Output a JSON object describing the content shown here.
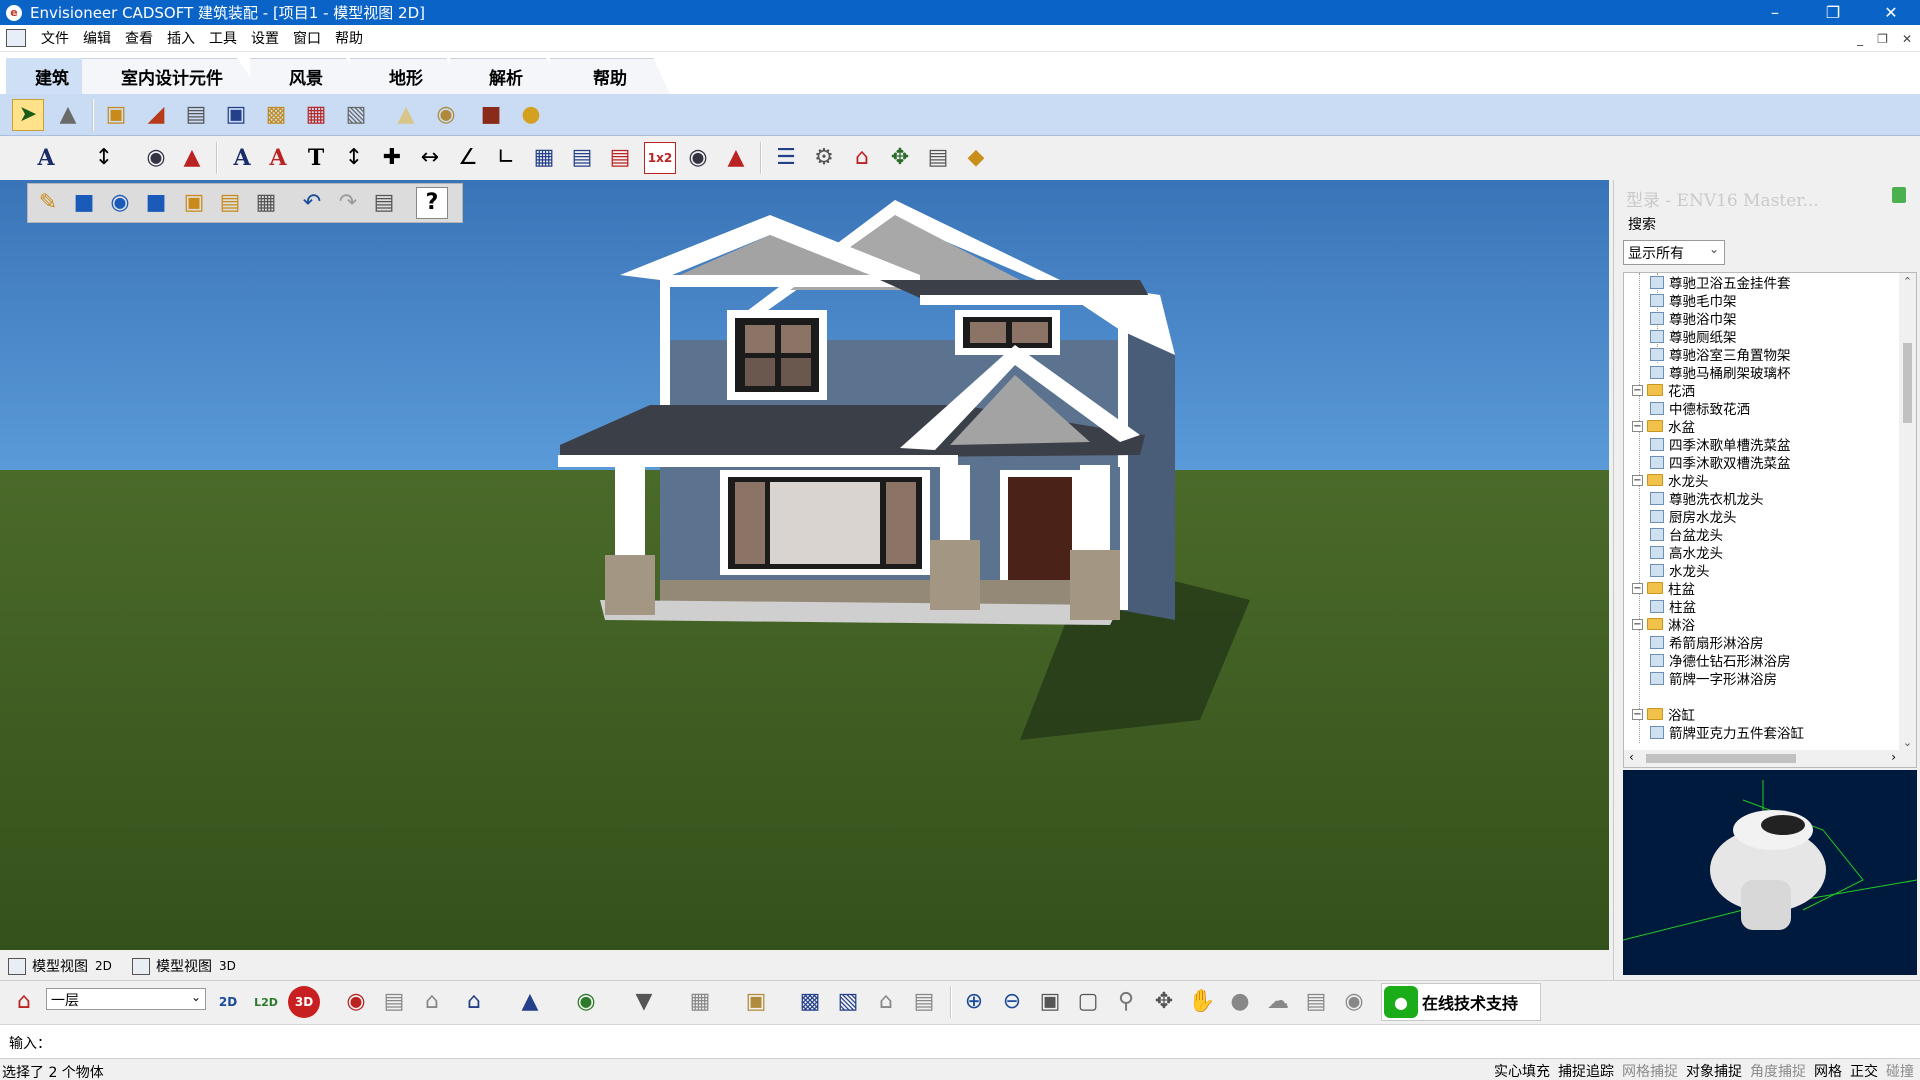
{
  "window": {
    "title": "Envisioneer CADSOFT 建筑装配 - [项目1 - 模型视图 2D]",
    "app_icon": "envisioneer-logo-icon",
    "controls": [
      "minimize-icon",
      "restore-icon",
      "close-icon"
    ]
  },
  "menu": {
    "items": [
      "文件",
      "编辑",
      "查看",
      "插入",
      "工具",
      "设置",
      "窗口",
      "帮助"
    ]
  },
  "ribbon": {
    "tabs": [
      "建筑",
      "室内设计元件",
      "风景",
      "地形",
      "解析",
      "帮助"
    ],
    "active_tab": "室内设计元件"
  },
  "toolbars": {
    "interior": [
      "select-arrow-icon",
      "paint-tool-icon",
      "cabinet-icon",
      "wall-cabinet-icon",
      "appliance-icon",
      "electronics-icon",
      "furniture-chair-icon",
      "window-treatment-icon",
      "fixture-icon",
      "lamp-icon",
      "plumbing-icon",
      "fireplace-icon",
      "misc-element-icon"
    ],
    "annotation": [
      "text-style-icon",
      "dimension-icon",
      "room-label-icon",
      "tag-icon",
      "text-icon",
      "text-edit-icon",
      "text-box-icon",
      "dimension-vertical-icon",
      "dimension-cross-icon",
      "dimension-horizontal-icon",
      "angle-dimension-icon",
      "elevation-icon",
      "stair-icon",
      "railing-icon",
      "ruler-icon",
      "scale-1x2-icon",
      "room-area-icon",
      "roof-tag-icon",
      "list-icon",
      "gear-icon",
      "house-view-icon",
      "resize-icon",
      "chart-icon",
      "layers-icon"
    ],
    "file": [
      "new-file-icon",
      "open-folder-icon",
      "open-web-icon",
      "folder-icon",
      "save-icon",
      "save-as-icon",
      "book-icon",
      "undo-icon",
      "redo-icon",
      "print-icon",
      "help-icon"
    ]
  },
  "viewport": {
    "sky_color": "#4a87c9",
    "grass_color": "#3d5a22",
    "house_siding_color": "#5c7390",
    "roof_color": "#3b3f47"
  },
  "library": {
    "title": "型录 - ENV16 Master...",
    "search_label": "搜索",
    "filter_value": "显示所有",
    "tree": [
      {
        "type": "item",
        "label": "尊驰卫浴五金挂件套"
      },
      {
        "type": "item",
        "label": "尊驰毛巾架"
      },
      {
        "type": "item",
        "label": "尊驰浴巾架"
      },
      {
        "type": "item",
        "label": "尊驰厕纸架"
      },
      {
        "type": "item",
        "label": "尊驰浴室三角置物架"
      },
      {
        "type": "item",
        "label": "尊驰马桶刷架玻璃杯"
      },
      {
        "type": "folder",
        "label": "花洒"
      },
      {
        "type": "item",
        "label": "中德标致花洒"
      },
      {
        "type": "folder",
        "label": "水盆"
      },
      {
        "type": "item",
        "label": "四季沐歌单槽洗菜盆"
      },
      {
        "type": "item",
        "label": "四季沐歌双槽洗菜盆"
      },
      {
        "type": "folder",
        "label": "水龙头"
      },
      {
        "type": "item",
        "label": "尊驰洗衣机龙头"
      },
      {
        "type": "item",
        "label": "厨房水龙头"
      },
      {
        "type": "item",
        "label": "台盆龙头"
      },
      {
        "type": "item",
        "label": "高水龙头"
      },
      {
        "type": "item",
        "label": "水龙头"
      },
      {
        "type": "folder",
        "label": "柱盆"
      },
      {
        "type": "item",
        "label": "柱盆"
      },
      {
        "type": "folder",
        "label": "淋浴"
      },
      {
        "type": "item",
        "label": "希箭扇形淋浴房"
      },
      {
        "type": "item",
        "label": "净德仕钻石形淋浴房"
      },
      {
        "type": "item",
        "label": "箭牌一字形淋浴房"
      },
      {
        "type": "folder",
        "label": "浴缸"
      },
      {
        "type": "item",
        "label": "箭牌亚克力五件套浴缸"
      }
    ],
    "preview_bg": "#001a3d"
  },
  "view_tabs": [
    {
      "label": "模型视图",
      "suffix": "2D"
    },
    {
      "label": "模型视图",
      "suffix": "3D"
    }
  ],
  "bottom_toolbar": {
    "layer_value": "一层",
    "support_label": "在线技术支持",
    "icons": [
      "layer-icon",
      "2d-view-icon",
      "split-2d-icon",
      "3d-view-icon",
      "camera-icon",
      "walkthrough-icon",
      "presentation-icon",
      "exterior-icon",
      "interior-icon",
      "roof-view-icon",
      "photo-icon",
      "lighting-icon",
      "wall-icon",
      "block-icon",
      "material-icon",
      "display-icon",
      "house-icon",
      "render-icon",
      "zoom-in-icon",
      "zoom-out-icon",
      "zoom-fit-icon",
      "zoom-window-icon",
      "zoom-icon",
      "zoom-extents-icon",
      "pan-hand-icon",
      "walk-icon",
      "orbit-icon",
      "rotate-icon",
      "camera-settings-icon",
      "wechat-icon"
    ]
  },
  "command": {
    "label": "输入：",
    "value": ""
  },
  "status": {
    "text": "选择了 2 个物体",
    "toggles": [
      {
        "label": "实心填充",
        "on": true
      },
      {
        "label": "捕捉追踪",
        "on": true
      },
      {
        "label": "网格捕捉",
        "on": false
      },
      {
        "label": "对象捕捉",
        "on": true
      },
      {
        "label": "角度捕捉",
        "on": false
      },
      {
        "label": "网格",
        "on": true
      },
      {
        "label": "正交",
        "on": true
      },
      {
        "label": "碰撞",
        "on": false
      }
    ]
  }
}
